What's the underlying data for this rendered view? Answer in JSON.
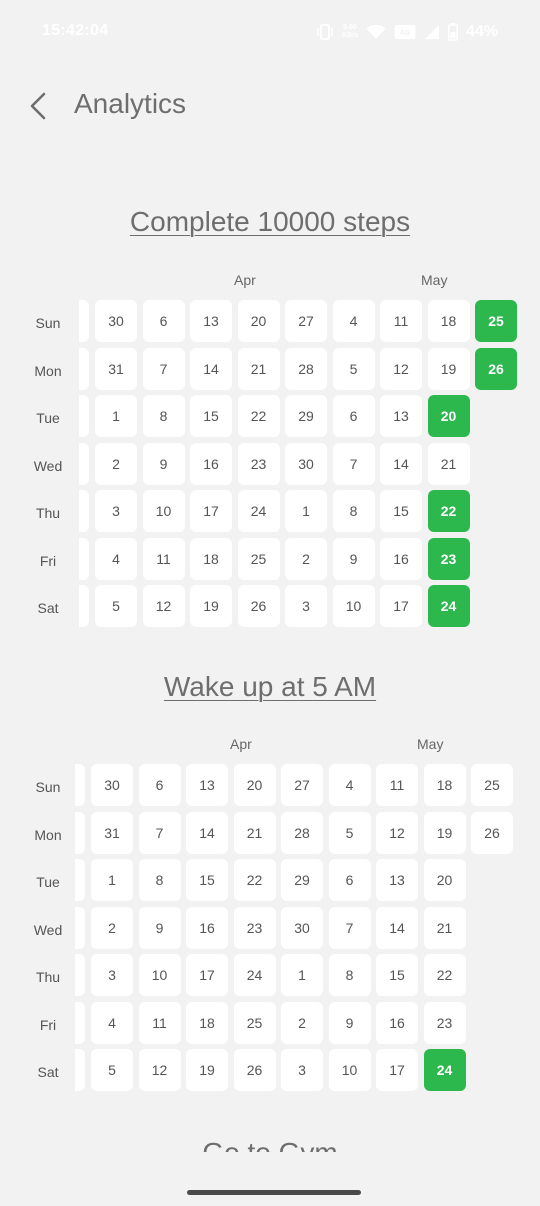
{
  "status": {
    "time": "15:42:04",
    "net_speed_value": "0.00",
    "net_speed_unit": "KB/s",
    "battery": "44%"
  },
  "header": {
    "title": "Analytics"
  },
  "day_labels": [
    "Sun",
    "Mon",
    "Tue",
    "Wed",
    "Thu",
    "Fri",
    "Sat"
  ],
  "habits": [
    {
      "title": "Complete 10000 steps",
      "month_labels": [
        "Apr",
        "May"
      ],
      "weeks": [
        [
          "30",
          "31",
          "1",
          "2",
          "3",
          "4",
          "5"
        ],
        [
          "6",
          "7",
          "8",
          "9",
          "10",
          "11",
          "12"
        ],
        [
          "13",
          "14",
          "15",
          "16",
          "17",
          "18",
          "19"
        ],
        [
          "20",
          "21",
          "22",
          "23",
          "24",
          "25",
          "26"
        ],
        [
          "27",
          "28",
          "29",
          "30",
          "1",
          "2",
          "3"
        ],
        [
          "4",
          "5",
          "6",
          "7",
          "8",
          "9",
          "10"
        ],
        [
          "11",
          "12",
          "13",
          "14",
          "15",
          "16",
          "17"
        ],
        [
          "18",
          "19",
          "20",
          "21",
          "22",
          "23",
          "24"
        ],
        [
          "25",
          "26",
          "",
          "",
          "",
          "",
          ""
        ]
      ],
      "completed": [
        "7-2",
        "7-4",
        "7-5",
        "7-6",
        "8-0",
        "8-1"
      ]
    },
    {
      "title": "Wake up at 5 AM",
      "month_labels": [
        "Apr",
        "May"
      ],
      "weeks": [
        [
          "30",
          "31",
          "1",
          "2",
          "3",
          "4",
          "5"
        ],
        [
          "6",
          "7",
          "8",
          "9",
          "10",
          "11",
          "12"
        ],
        [
          "13",
          "14",
          "15",
          "16",
          "17",
          "18",
          "19"
        ],
        [
          "20",
          "21",
          "22",
          "23",
          "24",
          "25",
          "26"
        ],
        [
          "27",
          "28",
          "29",
          "30",
          "1",
          "2",
          "3"
        ],
        [
          "4",
          "5",
          "6",
          "7",
          "8",
          "9",
          "10"
        ],
        [
          "11",
          "12",
          "13",
          "14",
          "15",
          "16",
          "17"
        ],
        [
          "18",
          "19",
          "20",
          "21",
          "22",
          "23",
          "24"
        ],
        [
          "25",
          "26",
          "",
          "",
          "",
          "",
          ""
        ]
      ],
      "completed": [
        "7-6"
      ]
    }
  ],
  "next_habit": {
    "title": "Go to Gym"
  },
  "colors": {
    "background": "#f2f2f2",
    "cell": "#ffffff",
    "completed": "#2db84d",
    "text": "#555555"
  }
}
